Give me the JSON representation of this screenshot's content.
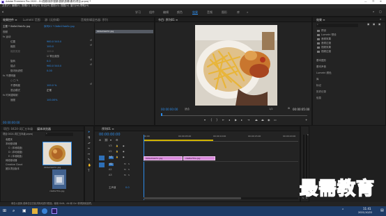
{
  "titlebar": {
    "title": "Adobe Premiere Pro 2020 - D:\\视频\\制作视频\\视频\\剪辑\\素材\\项目.prproj *",
    "controls": [
      "—",
      "❐",
      "✕"
    ]
  },
  "menu": [
    "文件(F)",
    "编辑(E)",
    "剪辑(C)",
    "序列(S)",
    "标记(M)",
    "图形(G)",
    "视图(V)",
    "窗口(W)",
    "帮助(H)"
  ],
  "workspaces": [
    "学习",
    "组件",
    "编辑",
    "颜色",
    "效果",
    "音频",
    "图形",
    "库",
    "»"
  ],
  "effect_controls": {
    "tabs": [
      "效果控件 ≡",
      "Lumetri 范围",
      "源: (无剪辑)",
      "音频剪辑混合器: 序列"
    ],
    "clip": "主要 * 0b6e19ab5c.jpg",
    "seq": "序列01 * 0b6e19ab5c.jpg",
    "clip_name": "0b6e19ab5c.jpg",
    "rows": [
      {
        "label": "视频",
        "value": ""
      },
      {
        "label": "fx 运动",
        "value": ""
      },
      {
        "label": "位置",
        "value": "960.0  540.0"
      },
      {
        "label": "缩放",
        "value": "100.0"
      },
      {
        "label": "缩放宽度",
        "value": "100.0"
      },
      {
        "label": "",
        "value": "☑ 等比缩放"
      },
      {
        "label": "旋转",
        "value": "0.0"
      },
      {
        "label": "锚点",
        "value": "960.0  540.0"
      },
      {
        "label": "防闪烁滤镜",
        "value": "0.00"
      },
      {
        "label": "fx 不透明度",
        "value": ""
      },
      {
        "label": "",
        "value": "○ □ ✎"
      },
      {
        "label": "不透明度",
        "value": "100.0 %"
      },
      {
        "label": "混合模式",
        "value": "正常"
      },
      {
        "label": "fx 时间重映射",
        "value": ""
      },
      {
        "label": "速度",
        "value": "100.00%"
      }
    ],
    "timecode": "00:00:00:00"
  },
  "program": {
    "tab": "节目: 序列01 ≡",
    "tc_left": "00:00:00:00",
    "fit": "适合",
    "quality": "1/2",
    "tc_right": "00:00:05:00"
  },
  "effects_panel": {
    "tab": "效果 ≡",
    "items": [
      "预设",
      "Lumetri 预设",
      "音频效果",
      "音频过渡",
      "视频效果",
      "视频过渡"
    ],
    "sections": [
      "基本图形",
      "基本声音",
      "Lumetri 颜色",
      "库",
      "标记",
      "历史记录",
      "信息"
    ]
  },
  "project": {
    "tabs": [
      "项目: 0424-词汇五年级",
      "媒体浏览器"
    ],
    "search": "搜索",
    "path": "项目:0424-词汇五年级.prproj",
    "tree": [
      "收藏夹",
      "本地驱动器",
      "C: (本地磁盘)",
      "D: (本地磁盘)",
      "E: (本地磁盘)",
      "网络驱动器",
      "Creative Cloud",
      "团队项目版本"
    ],
    "thumb1_label": "0b6e19ab5c.jpg",
    "thumb2_label": "c9e8a7f2a.jpg"
  },
  "timeline": {
    "tab": "序列01 ≡",
    "timecode": "00:00:00:00",
    "ruler": [
      "00:00",
      "00:00:05:00",
      "00:00:10:00",
      "00:00:15:00",
      "00:00:20:00"
    ],
    "tracks_v": [
      "V3",
      "V2",
      "V1"
    ],
    "tracks_a": [
      "A1",
      "A2",
      "A3"
    ],
    "master": "主声道",
    "master_val": "0.0",
    "clip1": "0b6e19ab5c.jpg",
    "clip2": "c9e8a7f2a.jpg",
    "meter_labels": [
      "0",
      "-12",
      "-24",
      "-36",
      "-48",
      "dB"
    ]
  },
  "status": "单击以选择,或单击空白处并拖动进行框选。使用 Shift、Alt 和 Ctrl 获得其他选项。",
  "taskbar": {
    "time": "11:41",
    "date": "2021/10/22"
  },
  "watermark": "最需教育",
  "colors": {
    "accent": "#2d8ceb",
    "clip": "#d98adb",
    "workarea": "#d1b300",
    "taskbar": "#1d3b66"
  }
}
